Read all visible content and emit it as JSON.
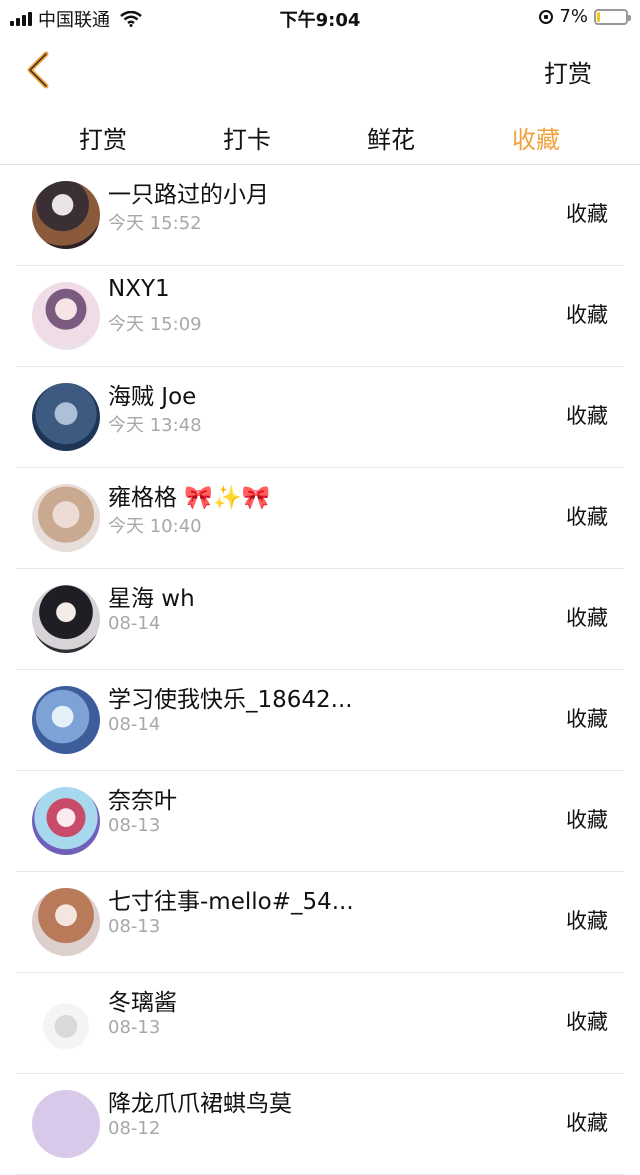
{
  "status_bar": {
    "carrier": "中国联通",
    "time": "下午9:04",
    "battery": "7%",
    "battery_level": 0.07
  },
  "nav": {
    "action_label": "打赏"
  },
  "tabs": [
    {
      "label": "打赏"
    },
    {
      "label": "打卡"
    },
    {
      "label": "鲜花"
    },
    {
      "label": "收藏",
      "active": true
    }
  ],
  "colors": {
    "accent": "#f0a23c",
    "date_gray": "#a8a8a8",
    "divider": "#e8e8e8"
  },
  "rows": [
    {
      "name": "一只路过的小月",
      "date": "今天 15:52",
      "label": "收藏"
    },
    {
      "name": "NXY1",
      "date": "今天 15:09",
      "label": "收藏"
    },
    {
      "name": "海贼 Joe",
      "date": "今天 13:48",
      "label": "收藏"
    },
    {
      "name": "雍格格 🎀✨🎀",
      "date": "今天 10:40",
      "label": "收藏"
    },
    {
      "name": "星海 wh",
      "date": "08-14",
      "label": "收藏"
    },
    {
      "name": "学习使我快乐_18642...",
      "date": "08-14",
      "label": "收藏"
    },
    {
      "name": "奈奈叶",
      "date": "08-13",
      "label": "收藏"
    },
    {
      "name": "七寸往事-mello#_54...",
      "date": "08-13",
      "label": "收藏"
    },
    {
      "name": "冬璃酱",
      "date": "08-13",
      "label": "收藏"
    },
    {
      "name": "降龙爪爪裙蜞鸟莫",
      "date": "08-12",
      "label": "收藏"
    }
  ]
}
